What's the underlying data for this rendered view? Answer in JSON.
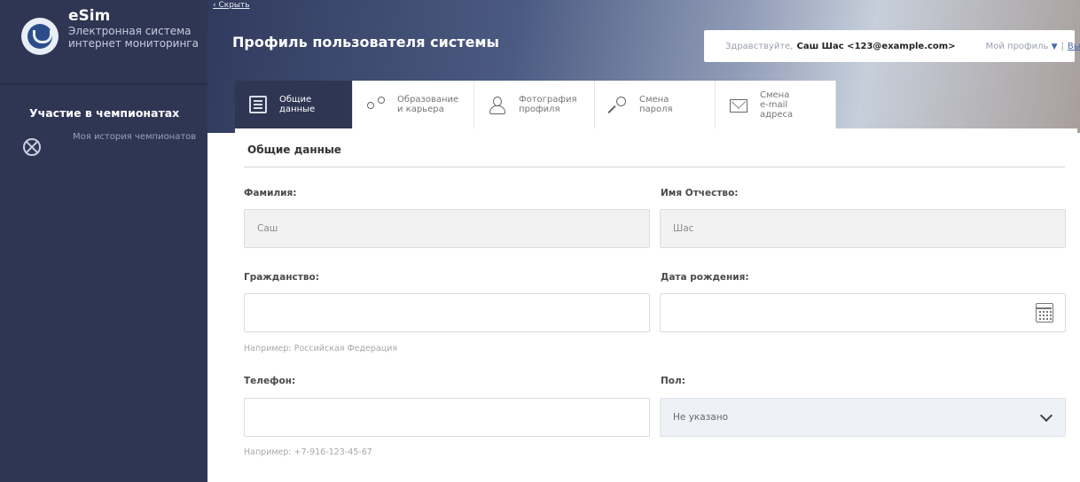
{
  "sidebar": {
    "brand_title": "eSim",
    "brand_subtitle_line1": "Электронная система",
    "brand_subtitle_line2": "интернет мониторинга",
    "heading": "Участие в чемпионатах",
    "items": [
      {
        "label": "Моя история чемпионатов",
        "icon": "lifebuoy-icon"
      }
    ]
  },
  "header": {
    "hide_link": "Скрыть",
    "title": "Профиль пользователя системы",
    "greeting": "Здравствуйте,",
    "user_name": "Саш Шас <123@example.com>",
    "my_profile": "Мой профиль",
    "separator": "|",
    "logout": "Выход"
  },
  "tabs": [
    {
      "label": "Общие\nданные",
      "icon": "document-icon",
      "active": true
    },
    {
      "label": "Образование\nи карьера",
      "icon": "share-icon",
      "active": false
    },
    {
      "label": "Фотография\nпрофиля",
      "icon": "person-icon",
      "active": false
    },
    {
      "label": "Смена\nпароля",
      "icon": "key-icon",
      "active": false
    },
    {
      "label": "Смена\ne-mail\nадреса",
      "icon": "mail-icon",
      "active": false
    }
  ],
  "form": {
    "section_title": "Общие данные",
    "last_name": {
      "label": "Фамилия:",
      "value": "Саш"
    },
    "first_middle_name": {
      "label": "Имя Отчество:",
      "value": "Шас"
    },
    "citizenship": {
      "label": "Гражданство:",
      "value": "",
      "hint": "Например: Российская Федерация"
    },
    "birth_date": {
      "label": "Дата рождения:",
      "value": ""
    },
    "phone": {
      "label": "Телефон:",
      "value": "",
      "hint": "Например: +7-916-123-45-67"
    },
    "gender": {
      "label": "Пол:",
      "selected": "Не указано"
    }
  },
  "colors": {
    "sidebar_bg": "#2f3653",
    "active_tab_bg": "#2f3653",
    "link": "#4a6aa6"
  }
}
